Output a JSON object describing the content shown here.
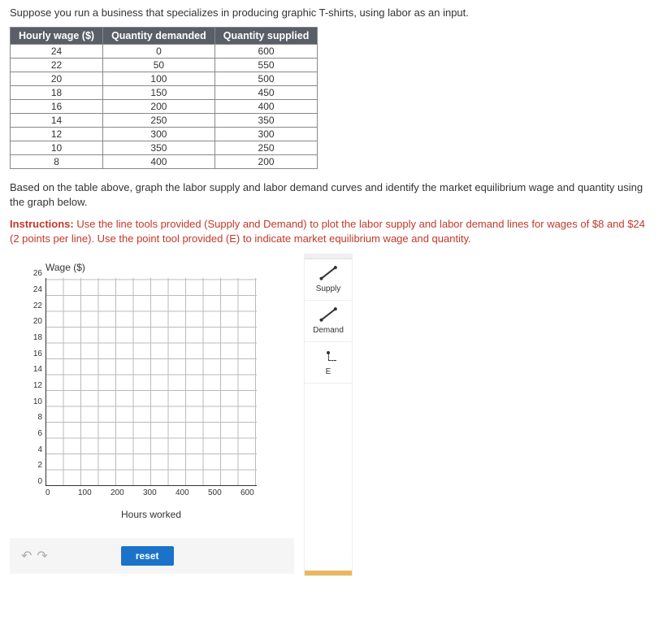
{
  "intro": "Suppose you run a business that specializes in producing graphic T-shirts, using labor as an input.",
  "table": {
    "headers": {
      "wage": "Hourly wage ($)",
      "demanded": "Quantity demanded",
      "supplied": "Quantity supplied"
    },
    "rows": [
      {
        "wage": "24",
        "demanded": "0",
        "supplied": "600"
      },
      {
        "wage": "22",
        "demanded": "50",
        "supplied": "550"
      },
      {
        "wage": "20",
        "demanded": "100",
        "supplied": "500"
      },
      {
        "wage": "18",
        "demanded": "150",
        "supplied": "450"
      },
      {
        "wage": "16",
        "demanded": "200",
        "supplied": "400"
      },
      {
        "wage": "14",
        "demanded": "250",
        "supplied": "350"
      },
      {
        "wage": "12",
        "demanded": "300",
        "supplied": "300"
      },
      {
        "wage": "10",
        "demanded": "350",
        "supplied": "250"
      },
      {
        "wage": "8",
        "demanded": "400",
        "supplied": "200"
      }
    ]
  },
  "para2": "Based on the table above, graph the labor supply and labor demand curves and identify the market equilibrium wage and quantity using the graph below.",
  "instructions_label": "Instructions:",
  "instructions_text": " Use the line tools provided (Supply and Demand) to plot the labor supply and labor demand lines for wages of $8 and $24 (2 points per line). Use the point tool provided (E) to indicate market equilibrium wage and quantity.",
  "chart": {
    "ylabel": "Wage ($)",
    "xlabel": "Hours worked",
    "yticks": [
      "26",
      "24",
      "22",
      "20",
      "18",
      "16",
      "14",
      "12",
      "10",
      "8",
      "6",
      "4",
      "2",
      "0"
    ],
    "xticks": [
      "0",
      "100",
      "200",
      "300",
      "400",
      "500",
      "600"
    ]
  },
  "tools": {
    "supply": "Supply",
    "demand": "Demand",
    "e": "E"
  },
  "controls": {
    "reset": "reset"
  },
  "chart_data": {
    "type": "line",
    "title": "",
    "xlabel": "Hours worked",
    "ylabel": "Wage ($)",
    "xlim": [
      0,
      600
    ],
    "ylim": [
      0,
      26
    ],
    "series": []
  }
}
